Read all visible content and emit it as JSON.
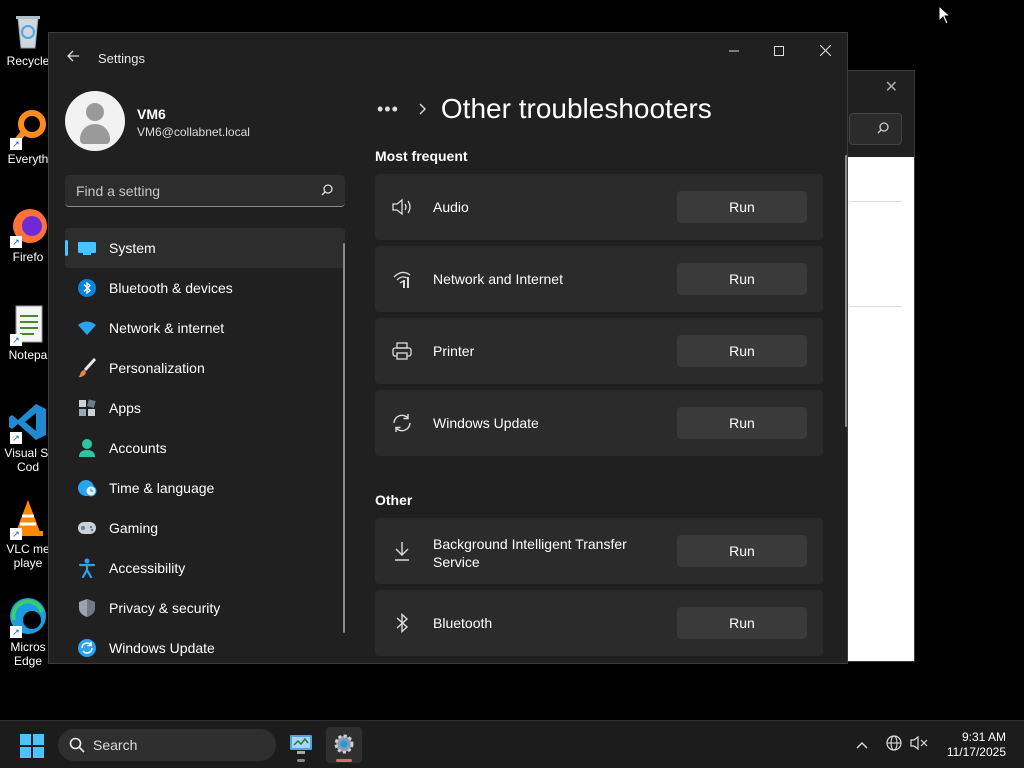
{
  "desktop": {
    "icons": [
      {
        "label": "Recycle",
        "icon": "recycle-bin-icon"
      },
      {
        "label": "Everyth",
        "icon": "everything-search-icon"
      },
      {
        "label": "Firefo",
        "icon": "firefox-icon"
      },
      {
        "label": "Notepa",
        "icon": "notepad-icon"
      },
      {
        "label": "Visual St\nCod",
        "icon": "vscode-icon"
      },
      {
        "label": "VLC me\nplaye",
        "icon": "vlc-icon"
      },
      {
        "label": "Micros\nEdge",
        "icon": "edge-icon"
      }
    ]
  },
  "window": {
    "title": "Settings",
    "controls": {
      "minimize": "—",
      "maximize": "☐",
      "close": "✕"
    }
  },
  "profile": {
    "name": "VM6",
    "email": "VM6@collabnet.local"
  },
  "search": {
    "placeholder": "Find a setting"
  },
  "nav": {
    "items": [
      {
        "label": "System",
        "icon": "system-display-icon",
        "active": true
      },
      {
        "label": "Bluetooth & devices",
        "icon": "bluetooth-icon"
      },
      {
        "label": "Network & internet",
        "icon": "wifi-icon"
      },
      {
        "label": "Personalization",
        "icon": "paintbrush-icon"
      },
      {
        "label": "Apps",
        "icon": "apps-icon"
      },
      {
        "label": "Accounts",
        "icon": "accounts-icon"
      },
      {
        "label": "Time & language",
        "icon": "globe-clock-icon"
      },
      {
        "label": "Gaming",
        "icon": "gamepad-icon"
      },
      {
        "label": "Accessibility",
        "icon": "accessibility-icon"
      },
      {
        "label": "Privacy & security",
        "icon": "shield-icon"
      },
      {
        "label": "Windows Update",
        "icon": "windows-update-icon"
      }
    ]
  },
  "page": {
    "breadcrumb_more": "•••",
    "title": "Other troubleshooters",
    "sections": {
      "most_frequent": "Most frequent",
      "other": "Other"
    },
    "most_frequent": [
      {
        "label": "Audio",
        "icon": "speaker-icon",
        "action": "Run"
      },
      {
        "label": "Network and Internet",
        "icon": "network-icon",
        "action": "Run"
      },
      {
        "label": "Printer",
        "icon": "printer-icon",
        "action": "Run"
      },
      {
        "label": "Windows Update",
        "icon": "sync-icon",
        "action": "Run"
      }
    ],
    "other": [
      {
        "label": "Background Intelligent Transfer Service",
        "icon": "download-icon",
        "action": "Run"
      },
      {
        "label": "Bluetooth",
        "icon": "bluetooth-icon",
        "action": "Run"
      }
    ]
  },
  "taskbar": {
    "search_label": "Search",
    "time": "9:31 AM",
    "date": "11/17/2025"
  },
  "colors": {
    "accent": "#4cc2ff",
    "window_bg": "#202020",
    "card_bg": "#2b2b2b",
    "button_bg": "#3a3a3a"
  }
}
